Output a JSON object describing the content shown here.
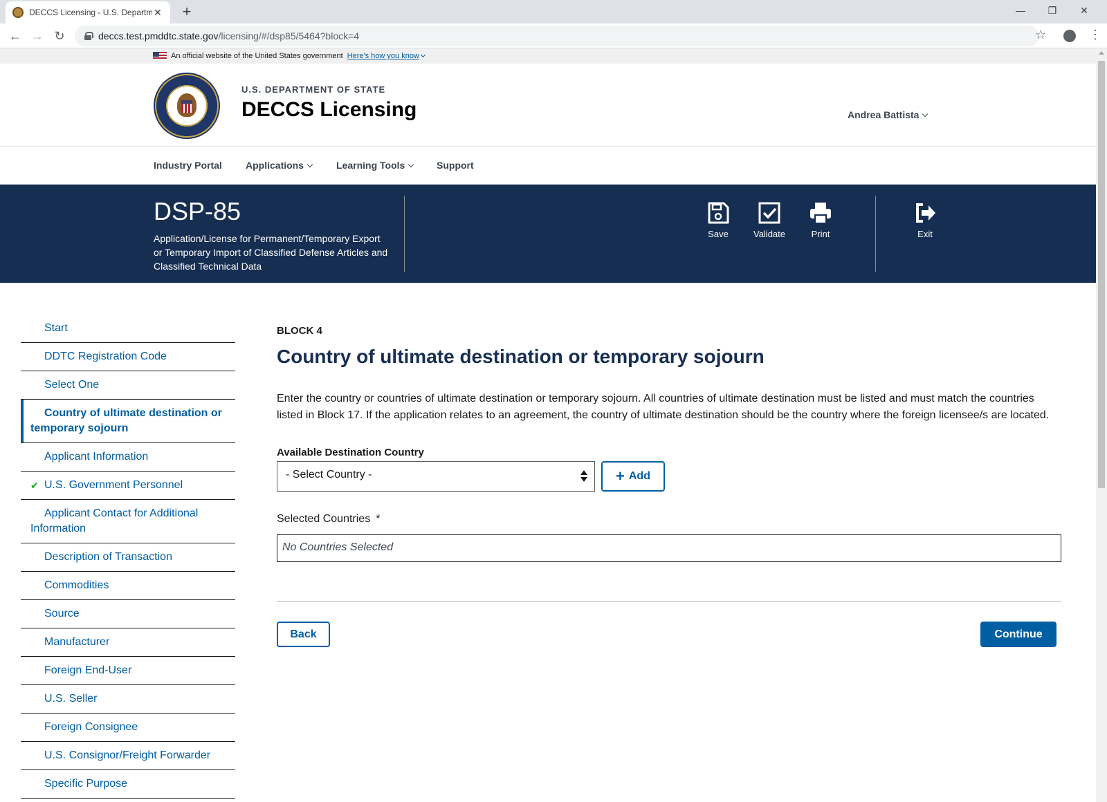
{
  "browser": {
    "tab_title": "DECCS Licensing - U.S. Departme",
    "url_host": "deccs.test.pmddtc.state.gov",
    "url_path": "/licensing/#/dsp85/5464?block=4"
  },
  "gov_banner": {
    "text": "An official website of the United States government",
    "link": "Here's how you know"
  },
  "header": {
    "department": "U.S. DEPARTMENT OF STATE",
    "app_name": "DECCS Licensing",
    "user": "Andrea Battista"
  },
  "nav": {
    "items": [
      "Industry Portal",
      "Applications",
      "Learning Tools",
      "Support"
    ]
  },
  "form_banner": {
    "form_id": "DSP-85",
    "description": "Application/License for Permanent/Temporary Export or Temporary Import of Classified Defense Articles and Classified Technical Data",
    "actions": {
      "save": "Save",
      "validate": "Validate",
      "print": "Print",
      "exit": "Exit"
    }
  },
  "sidenav": {
    "items": [
      "Start",
      "DDTC Registration Code",
      "Select One",
      "Country of ultimate destination or temporary sojourn",
      "Applicant Information",
      "U.S. Government Personnel",
      "Applicant Contact for Additional Information",
      "Description of Transaction",
      "Commodities",
      "Source",
      "Manufacturer",
      "Foreign End-User",
      "U.S. Seller",
      "Foreign Consignee",
      "U.S. Consignor/Freight Forwarder",
      "Specific Purpose"
    ],
    "current_index": 3,
    "completed_index": 5
  },
  "block": {
    "label": "BLOCK 4",
    "title": "Country of ultimate destination or temporary sojourn",
    "description": "Enter the country or countries of ultimate destination or temporary sojourn. All countries of ultimate destination must be listed and must match the countries listed in Block 17. If the application relates to an agreement, the country of ultimate destination should be the country where the foreign licensee/s are located.",
    "field_label": "Available Destination Country",
    "select_value": "- Select Country -",
    "add_label": "Add",
    "selected_label": "Selected Countries",
    "required_marker": "*",
    "selected_empty": "No Countries Selected",
    "back_label": "Back",
    "continue_label": "Continue"
  },
  "colors": {
    "primary": "#005ea2",
    "banner_bg": "#162e51",
    "success": "#00a91c"
  }
}
